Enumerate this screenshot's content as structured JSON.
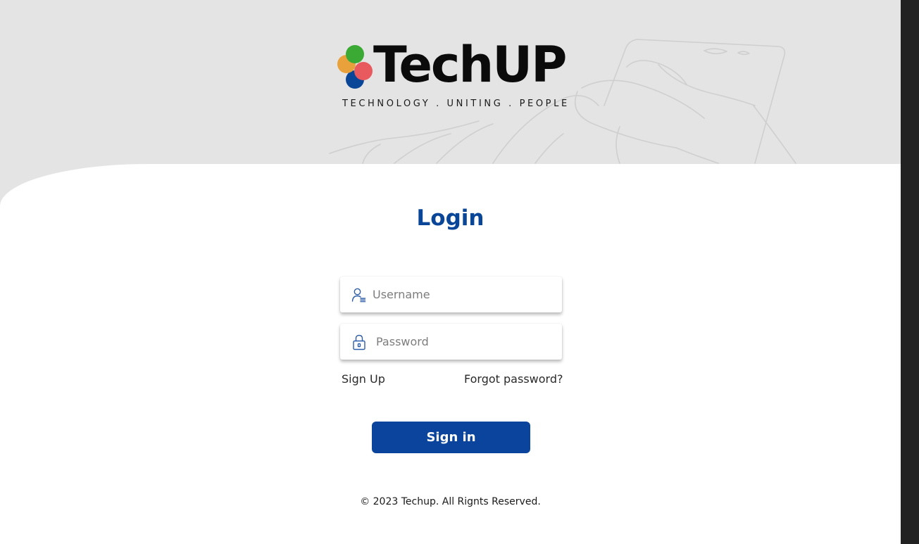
{
  "brand": {
    "name": "TechUP",
    "tagline": "TECHNOLOGY . UNITING . PEOPLE",
    "dot_colors": [
      "#3aaa35",
      "#e8a13b",
      "#e85a5e",
      "#0a4698"
    ]
  },
  "login": {
    "title": "Login",
    "username": {
      "value": "",
      "placeholder": "Username",
      "icon": "user-icon"
    },
    "password": {
      "value": "",
      "placeholder": "Password",
      "icon": "lock-icon"
    },
    "signup_label": "Sign Up",
    "forgot_label": "Forgot password?",
    "signin_label": "Sign in"
  },
  "footer": {
    "copyright": "© 2023 Techup. All Rignts Reserved."
  },
  "colors": {
    "accent": "#0a449c",
    "title": "#0a4698",
    "header_bg": "#e4e4e4"
  }
}
